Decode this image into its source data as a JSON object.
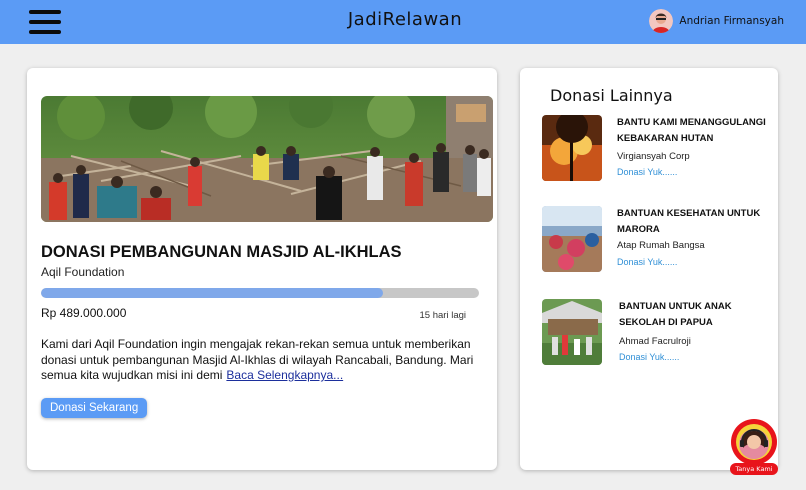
{
  "header": {
    "brand": "JadiRelawan",
    "user_name": "Andrian Firmansyah"
  },
  "main_campaign": {
    "title": "DONASI PEMBANGUNAN MASJID AL-IKHLAS",
    "organization": "Aqil Foundation",
    "progress_fraction": 0.78,
    "amount": "Rp 489.000.000",
    "days_left": "15 hari lagi",
    "description": "Kami dari Aqil Foundation ingin mengajak rekan-rekan semua untuk memberikan donasi untuk pembangunan Masjid Al-Ikhlas di wilayah Rancabali, Bandung. Mari semua kita wujudkan misi ini demi",
    "read_more": "Baca Selengkapnya...",
    "donate_button": "Donasi Sekarang"
  },
  "sidebar": {
    "title": "Donasi Lainnya",
    "items": [
      {
        "title": "BANTU KAMI MENANGGULANGI KEBAKARAN HUTAN",
        "organization": "Virgiansyah Corp",
        "link": "Donasi Yuk......"
      },
      {
        "title": "BANTUAN KESEHATAN UNTUK MARORA",
        "organization": "Atap Rumah Bangsa",
        "link": "Donasi Yuk......"
      },
      {
        "title": "BANTUAN UNTUK ANAK SEKOLAH DI PAPUA",
        "organization": "Ahmad Facrulroji",
        "link": "Donasi Yuk......"
      }
    ]
  },
  "help_widget": {
    "label": "Tanya Kami"
  },
  "colors": {
    "header": "#5b9bf5",
    "progress": "#7fa8ea",
    "link": "#2f8fd6",
    "help": "#e8141b"
  },
  "icons": {
    "menu": "hamburger-menu-icon",
    "user": "user-avatar",
    "help": "support-agent-icon"
  }
}
